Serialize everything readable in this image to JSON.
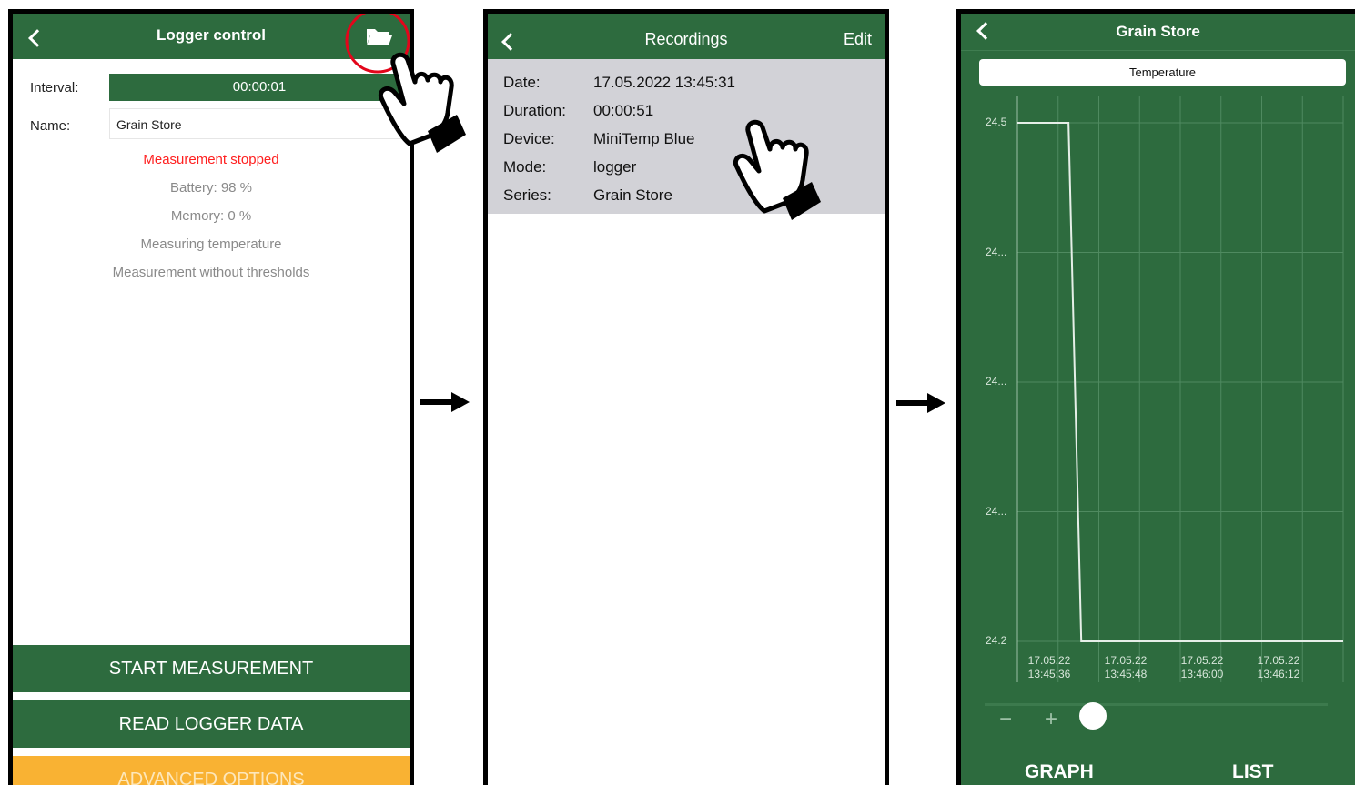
{
  "screen1": {
    "title": "Logger control",
    "interval_label": "Interval:",
    "interval_value": "00:00:01",
    "name_label": "Name:",
    "name_value": "Grain Store",
    "status": "Measurement stopped",
    "battery": "Battery: 98 %",
    "memory": "Memory: 0 %",
    "measuring": "Measuring temperature",
    "thresholds": "Measurement without thresholds",
    "start_button": "START MEASUREMENT",
    "read_button": "READ LOGGER DATA",
    "advanced_button": "ADVANCED OPTIONS"
  },
  "screen2": {
    "title": "Recordings",
    "edit": "Edit",
    "record": {
      "date_label": "Date:",
      "date_value": "17.05.2022 13:45:31",
      "duration_label": "Duration:",
      "duration_value": "00:00:51",
      "device_label": "Device:",
      "device_value": "MiniTemp Blue",
      "mode_label": "Mode:",
      "mode_value": "logger",
      "series_label": "Series:",
      "series_value": "Grain Store"
    }
  },
  "screen3": {
    "title": "Grain Store",
    "selector": "Temperature",
    "zoom_minus": "−",
    "zoom_plus": "+",
    "tab_graph": "GRAPH",
    "tab_list": "LIST"
  },
  "chart_data": {
    "type": "line",
    "y_tick_labels": [
      "24.5",
      "24...",
      "24...",
      "24...",
      "24.2"
    ],
    "x_tick_labels": [
      {
        "date": "17.05.22",
        "time": "13:45:36"
      },
      {
        "date": "17.05.22",
        "time": "13:45:48"
      },
      {
        "date": "17.05.22",
        "time": "13:46:00"
      },
      {
        "date": "17.05.22",
        "time": "13:46:12"
      }
    ],
    "ylim": [
      24.2,
      24.5
    ],
    "xlim": [
      "13:45:30",
      "13:46:21"
    ],
    "series": [
      {
        "x": [
          "13:45:30",
          "13:45:38",
          "13:45:40",
          "13:46:21"
        ],
        "values": [
          24.5,
          24.5,
          24.2,
          24.2
        ]
      }
    ],
    "grid": true,
    "line_color": "#e6efe8",
    "background": "#2d6b3e"
  },
  "colors": {
    "header_green": "#2d6b3e",
    "status_red": "#ff2020",
    "advanced_orange": "#f9b233",
    "record_gray": "#d2d2d7",
    "highlight_circle": "#e3061b"
  },
  "icons": {
    "back": "chevron-left-icon",
    "folder": "folder-icon",
    "pointer": "pointing-hand-icon",
    "arrow": "right-arrow-icon"
  }
}
